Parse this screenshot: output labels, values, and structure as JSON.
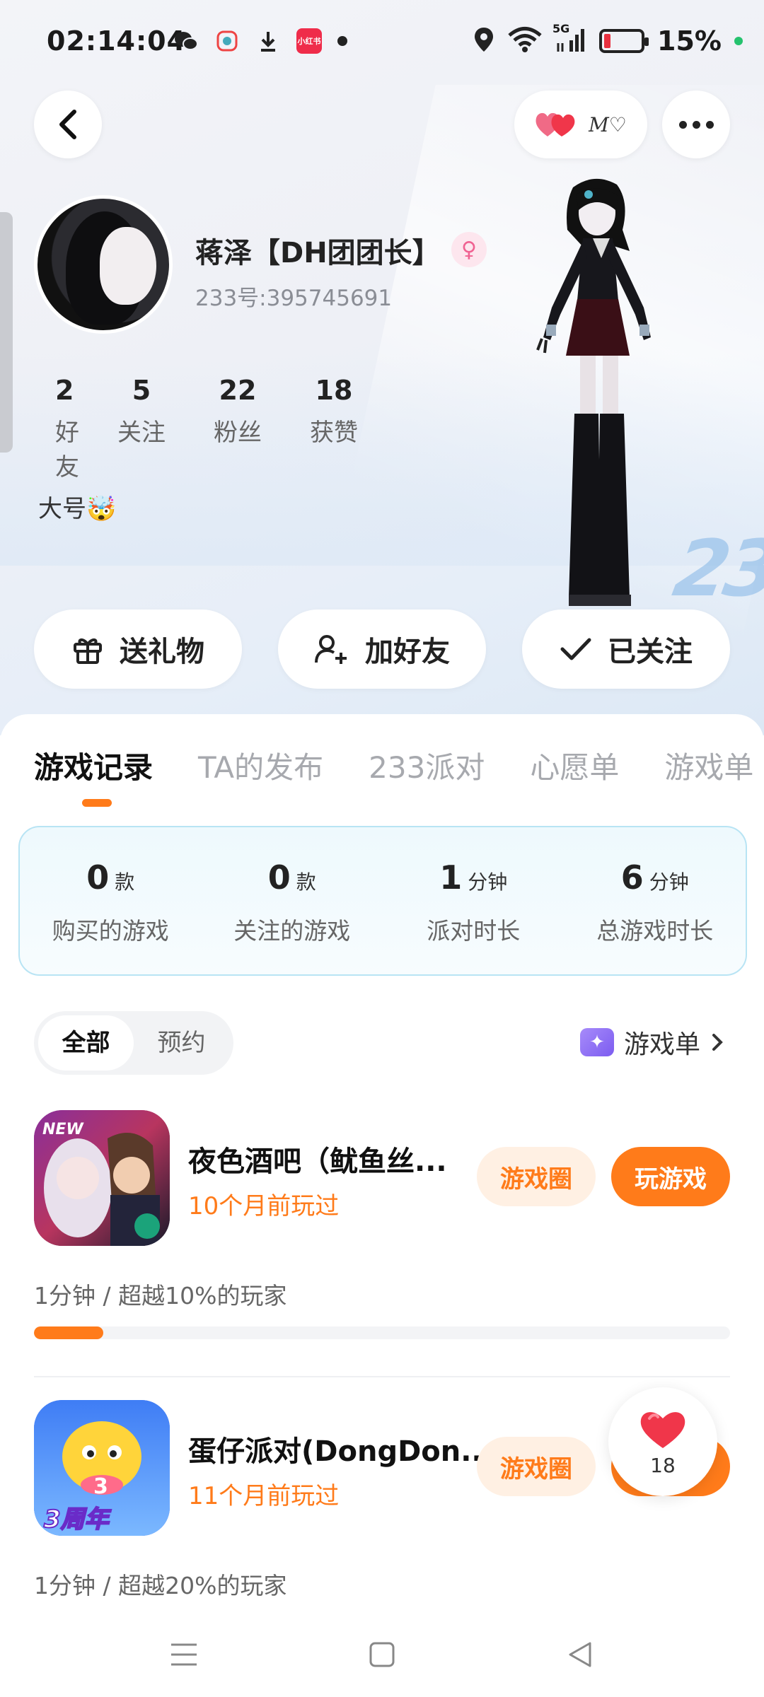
{
  "status_bar": {
    "time": "02:14:04",
    "network": "5G",
    "battery": "15%"
  },
  "header": {
    "signature_text": "M♡"
  },
  "profile": {
    "name": "蒋泽【DH团团长】",
    "gender_symbol": "♀",
    "uid": "233号:395745691",
    "stats": [
      {
        "value": "2",
        "label": "好友"
      },
      {
        "value": "5",
        "label": "关注"
      },
      {
        "value": "22",
        "label": "粉丝"
      },
      {
        "value": "18",
        "label": "获赞"
      }
    ],
    "bio": "大号🤯"
  },
  "actions": {
    "gift": "送礼物",
    "add_friend": "加好友",
    "following": "已关注"
  },
  "tabs": [
    "游戏记录",
    "TA的发布",
    "233派对",
    "心愿单",
    "游戏单"
  ],
  "summary": [
    {
      "value": "0",
      "unit": "款",
      "label": "购买的游戏"
    },
    {
      "value": "0",
      "unit": "款",
      "label": "关注的游戏"
    },
    {
      "value": "1",
      "unit": "分钟",
      "label": "派对时长"
    },
    {
      "value": "6",
      "unit": "分钟",
      "label": "总游戏时长"
    }
  ],
  "filter": {
    "all": "全部",
    "reserve": "预约",
    "game_list": "游戏单"
  },
  "games": [
    {
      "title": "夜色酒吧（鱿鱼丝...",
      "played": "10个月前玩过",
      "circle_label": "游戏圈",
      "play_label": "玩游戏",
      "stat": "1分钟 / 超越10%的玩家",
      "progress": 0.1
    },
    {
      "title": "蛋仔派对(DongDon...",
      "played": "11个月前玩过",
      "circle_label": "游戏圈",
      "stat": "1分钟 / 超越20%的玩家"
    }
  ],
  "icon_badges": {
    "game2_number": "3",
    "game2_anniversary": "3周年",
    "game1_new": "NEW"
  },
  "like_count": "18",
  "colors": {
    "accent": "#ff7b1a",
    "accent_light": "#fff0e3",
    "summary_border": "#b8e4f4",
    "like_red": "#f0364a"
  }
}
